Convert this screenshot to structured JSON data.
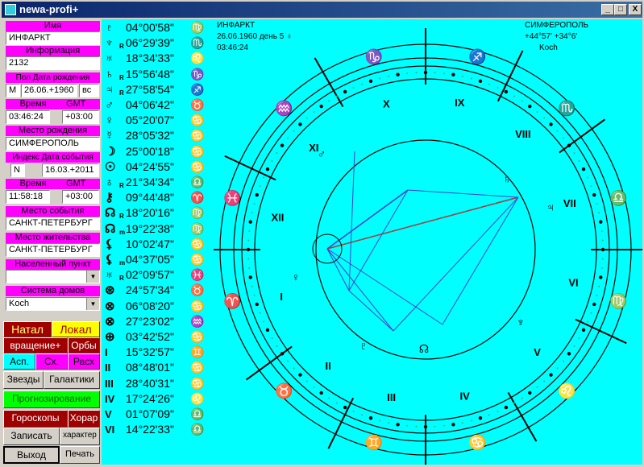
{
  "window": {
    "title": "newa-profi+",
    "btn_min": "_",
    "btn_max": "□",
    "btn_close": "X"
  },
  "left": {
    "name_label": "Имя",
    "name_value": "ИНФАРКТ",
    "info_label": "Информация",
    "info_value": "2132",
    "sex_label": "Пол",
    "birth_label": "Дата рождения",
    "sex_value": "М",
    "birth_date": "26.06.+1960",
    "weekday": "вс",
    "time_label": "Время",
    "gmt_label": "GMT",
    "time_value": "03:46:24",
    "gmt_value": "+03:00",
    "birthplace_label": "Место рождения",
    "birthplace_value": "СИМФЕРОПОЛЬ",
    "index_label": "Индекс",
    "event_date_label": "Дата события",
    "index_value": "N",
    "event_date": "16.03.+2011",
    "time2_label": "Время",
    "gmt2_label": "GMT",
    "time2_value": "11:58:18",
    "gmt2_value": "+03:00",
    "event_place_label": "Место события",
    "event_place_value": "САНКТ-ПЕТЕРБУРГ",
    "residence_label": "Место жительства",
    "residence_value": "САНКТ-ПЕТЕРБУРГ",
    "settlement_label": "Населенный пункт",
    "settlement_value": "",
    "houses_label": "Система домов",
    "houses_value": "Koch",
    "natal": "Натал",
    "local": "Локал",
    "rotation": "вращение+",
    "orbs": "Орбы",
    "asp": "Асп.",
    "sh": "Сх.",
    "calc": "Расх",
    "stars": "Звезды",
    "galaxies": "Галактики",
    "forecast": "Прогнозирование",
    "horoscopes": "Гороскопы",
    "horary": "Хорар",
    "save": "Записать",
    "character": "характер",
    "exit": "Выход",
    "print": "Печать"
  },
  "planets": [
    {
      "glyph": "♇",
      "r": "",
      "pos": "04°00'58\"",
      "sign": "♍"
    },
    {
      "glyph": "♆",
      "r": "R",
      "pos": "06°29'39\"",
      "sign": "♏"
    },
    {
      "glyph": "♅",
      "r": "",
      "pos": "18°34'33\"",
      "sign": "♌"
    },
    {
      "glyph": "♄",
      "r": "R",
      "pos": "15°56'48\"",
      "sign": "♑"
    },
    {
      "glyph": "♃",
      "r": "R",
      "pos": "27°58'54\"",
      "sign": "♐"
    },
    {
      "glyph": "♂",
      "r": "",
      "pos": "04°06'42\"",
      "sign": "♉"
    },
    {
      "glyph": "♀",
      "r": "",
      "pos": "05°20'07\"",
      "sign": "♋"
    },
    {
      "glyph": "☿",
      "r": "",
      "pos": "28°05'32\"",
      "sign": "♋"
    },
    {
      "glyph": "☽",
      "r": "",
      "pos": "25°00'18\"",
      "sign": "♋"
    },
    {
      "glyph": "☉",
      "r": "",
      "pos": "04°24'55\"",
      "sign": "♋"
    },
    {
      "glyph": "♁",
      "r": "R",
      "pos": "21°34'34\"",
      "sign": "♎"
    },
    {
      "glyph": "⚷",
      "r": "",
      "pos": "09°44'48\"",
      "sign": "♈"
    },
    {
      "glyph": "☊",
      "r": "R",
      "pos": "18°20'16\"",
      "sign": "♍"
    },
    {
      "glyph": "☊",
      "r": "m",
      "pos": "19°22'38\"",
      "sign": "♍"
    },
    {
      "glyph": "⚸",
      "r": "",
      "pos": "10°02'47\"",
      "sign": "♋"
    },
    {
      "glyph": "⚸",
      "r": "m",
      "pos": "04°37'05\"",
      "sign": "♋"
    },
    {
      "glyph": "♅",
      "r": "R",
      "pos": "02°09'57\"",
      "sign": "♓"
    },
    {
      "glyph": "⊛",
      "r": "",
      "pos": "24°57'34\"",
      "sign": "♉"
    },
    {
      "glyph": "⊗",
      "r": "",
      "pos": "06°08'20\"",
      "sign": "♋"
    },
    {
      "glyph": "⊗",
      "r": "",
      "pos": "27°23'02\"",
      "sign": "♒"
    },
    {
      "glyph": "⊕",
      "r": "",
      "pos": "03°42'52\"",
      "sign": "♋"
    },
    {
      "glyph": "I",
      "r": "",
      "pos": "15°32'57\"",
      "sign": "♊"
    },
    {
      "glyph": "II",
      "r": "",
      "pos": "08°48'01\"",
      "sign": "♋"
    },
    {
      "glyph": "III",
      "r": "",
      "pos": "28°40'31\"",
      "sign": "♋"
    },
    {
      "glyph": "IV",
      "r": "",
      "pos": "17°24'26\"",
      "sign": "♌"
    },
    {
      "glyph": "V",
      "r": "",
      "pos": "01°07'09\"",
      "sign": "♎"
    },
    {
      "glyph": "VI",
      "r": "",
      "pos": "14°22'33\"",
      "sign": "♎"
    }
  ],
  "chart": {
    "name": "ИНФАРКТ",
    "date": "26.06.1960 день",
    "weekday_glyph": "5 ♁",
    "time": "03:46:24",
    "city": "СИМФЕРОПОЛЬ",
    "coords": "+44°57' +34°6'",
    "system": "Koch",
    "houses": [
      "I",
      "II",
      "III",
      "IV",
      "V",
      "VI",
      "VII",
      "VIII",
      "IX",
      "X",
      "XI",
      "XII"
    ],
    "inner_glyphs": [
      "♂",
      "♄",
      "♃",
      "♀",
      "♆",
      "☊",
      "♇"
    ]
  }
}
